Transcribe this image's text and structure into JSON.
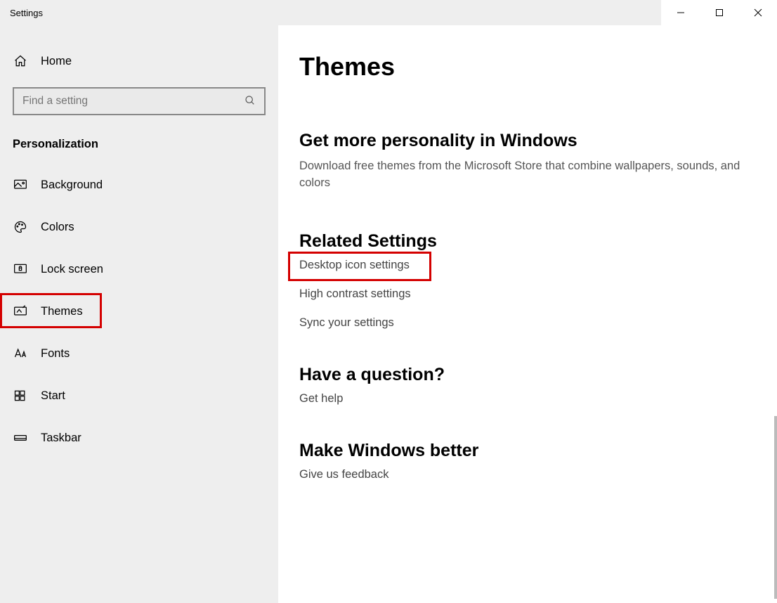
{
  "window": {
    "title": "Settings"
  },
  "sidebar": {
    "home": "Home",
    "search_placeholder": "Find a setting",
    "heading": "Personalization",
    "items": [
      {
        "label": "Background"
      },
      {
        "label": "Colors"
      },
      {
        "label": "Lock screen"
      },
      {
        "label": "Themes"
      },
      {
        "label": "Fonts"
      },
      {
        "label": "Start"
      },
      {
        "label": "Taskbar"
      }
    ]
  },
  "main": {
    "title": "Themes",
    "personality": {
      "heading": "Get more personality in Windows",
      "body": "Download free themes from the Microsoft Store that combine wallpapers, sounds, and colors"
    },
    "related": {
      "heading": "Related Settings",
      "links": [
        "Desktop icon settings",
        "High contrast settings",
        "Sync your settings"
      ]
    },
    "question": {
      "heading": "Have a question?",
      "link": "Get help"
    },
    "better": {
      "heading": "Make Windows better",
      "link": "Give us feedback"
    }
  }
}
